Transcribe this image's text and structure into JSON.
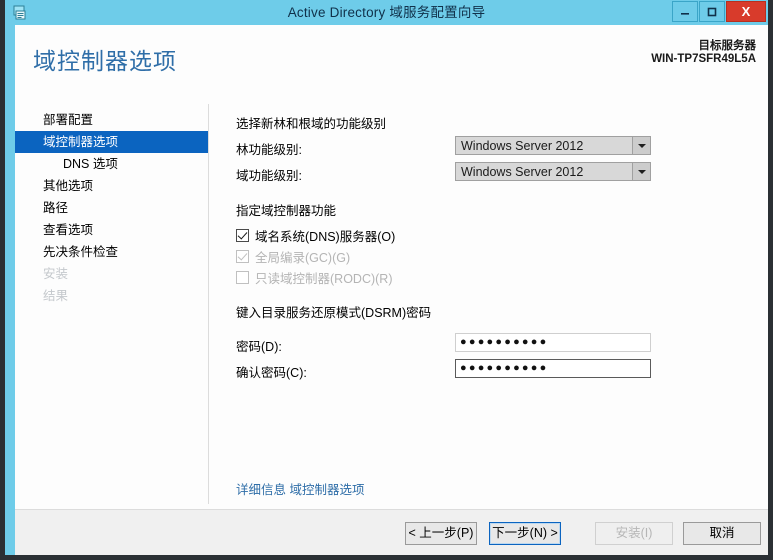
{
  "window": {
    "title": "Active Directory 域服务配置向导",
    "app_icon": "ad-server-icon",
    "controls": {
      "minimize": "–",
      "maximize": "☐",
      "close": "X"
    }
  },
  "header": {
    "page_title": "域控制器选项",
    "target_server_label": "目标服务器",
    "target_server_name": "WIN-TP7SFR49L5A"
  },
  "sidebar": {
    "items": [
      {
        "label": "部署配置",
        "selected": false,
        "disabled": false,
        "indent": false
      },
      {
        "label": "域控制器选项",
        "selected": true,
        "disabled": false,
        "indent": false
      },
      {
        "label": "DNS 选项",
        "selected": false,
        "disabled": false,
        "indent": true
      },
      {
        "label": "其他选项",
        "selected": false,
        "disabled": false,
        "indent": false
      },
      {
        "label": "路径",
        "selected": false,
        "disabled": false,
        "indent": false
      },
      {
        "label": "查看选项",
        "selected": false,
        "disabled": false,
        "indent": false
      },
      {
        "label": "先决条件检查",
        "selected": false,
        "disabled": false,
        "indent": false
      },
      {
        "label": "安装",
        "selected": false,
        "disabled": true,
        "indent": false
      },
      {
        "label": "结果",
        "selected": false,
        "disabled": true,
        "indent": false
      }
    ]
  },
  "main": {
    "functional_level": {
      "heading": "选择新林和根域的功能级别",
      "forest_label": "林功能级别:",
      "forest_value": "Windows Server 2012",
      "domain_label": "域功能级别:",
      "domain_value": "Windows Server 2012"
    },
    "capabilities": {
      "heading": "指定域控制器功能",
      "options": [
        {
          "label": "域名系统(DNS)服务器(O)",
          "checked": true,
          "disabled": false
        },
        {
          "label": "全局编录(GC)(G)",
          "checked": true,
          "disabled": true
        },
        {
          "label": "只读域控制器(RODC)(R)",
          "checked": false,
          "disabled": true
        }
      ]
    },
    "dsrm": {
      "heading": "键入目录服务还原模式(DSRM)密码",
      "password_label": "密码(D):",
      "password_value": "●●●●●●●●●●",
      "confirm_label": "确认密码(C):",
      "confirm_value": "●●●●●●●●●●"
    },
    "more_info_link": "详细信息 域控制器选项"
  },
  "footer": {
    "previous": "< 上一步(P)",
    "next": "下一步(N) >",
    "install": "安装(I)",
    "cancel": "取消"
  },
  "colors": {
    "titlebar": "#6ecce9",
    "accent_blue": "#0b64c0",
    "link": "#2f6ea8",
    "close_red": "#d83b2b",
    "footer_bg": "#f0f0f0"
  }
}
